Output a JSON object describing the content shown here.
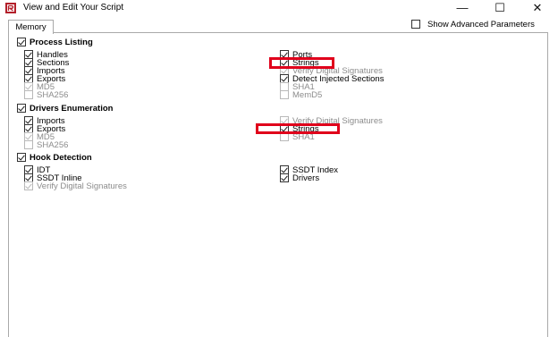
{
  "window": {
    "title": "View and Edit Your Script",
    "minimize_glyph": "—",
    "maximize_glyph": "☐",
    "close_glyph": "✕",
    "icon": "app-icon"
  },
  "tabs": [
    {
      "label": "Memory"
    }
  ],
  "advanced": {
    "label": "Show Advanced Parameters",
    "checked": false
  },
  "highlight_color": "#e0001b",
  "sections": {
    "process_listing": {
      "header": {
        "label": "Process Listing",
        "checked": true
      },
      "items": {
        "handles": {
          "label": "Handles",
          "checked": true
        },
        "sections": {
          "label": "Sections",
          "checked": true
        },
        "imports": {
          "label": "Imports",
          "checked": true
        },
        "exports": {
          "label": "Exports",
          "checked": true
        },
        "md5": {
          "label": "MD5",
          "checked": true,
          "disabled": true
        },
        "sha256": {
          "label": "SHA256",
          "checked": false,
          "disabled": true
        },
        "ports": {
          "label": "Ports",
          "checked": true
        },
        "strings": {
          "label": "Strings",
          "checked": true
        },
        "verify_sigs": {
          "label": "Verify Digital Signatures",
          "checked": true,
          "disabled": true
        },
        "detect_injected": {
          "label": "Detect Injected Sections",
          "checked": true
        },
        "sha1": {
          "label": "SHA1",
          "checked": false,
          "disabled": true
        },
        "memd5": {
          "label": "MemD5",
          "checked": false,
          "disabled": true
        }
      }
    },
    "drivers_enumeration": {
      "header": {
        "label": "Drivers Enumeration",
        "checked": true
      },
      "items": {
        "imports": {
          "label": "Imports",
          "checked": true
        },
        "exports": {
          "label": "Exports",
          "checked": true
        },
        "md5": {
          "label": "MD5",
          "checked": true,
          "disabled": true
        },
        "sha256": {
          "label": "SHA256",
          "checked": false,
          "disabled": true
        },
        "verify_sigs": {
          "label": "Verify Digital Signatures",
          "checked": true,
          "disabled": true
        },
        "strings": {
          "label": "Strings",
          "checked": true
        },
        "sha1": {
          "label": "SHA1",
          "checked": false,
          "disabled": true
        }
      }
    },
    "hook_detection": {
      "header": {
        "label": "Hook Detection",
        "checked": true
      },
      "items": {
        "idt": {
          "label": "IDT",
          "checked": true
        },
        "ssdt_inline": {
          "label": "SSDT Inline",
          "checked": true
        },
        "verify_sigs": {
          "label": "Verify Digital Signatures",
          "checked": true,
          "disabled": true
        },
        "ssdt_index": {
          "label": "SSDT Index",
          "checked": true
        },
        "drivers": {
          "label": "Drivers",
          "checked": true
        }
      }
    }
  }
}
